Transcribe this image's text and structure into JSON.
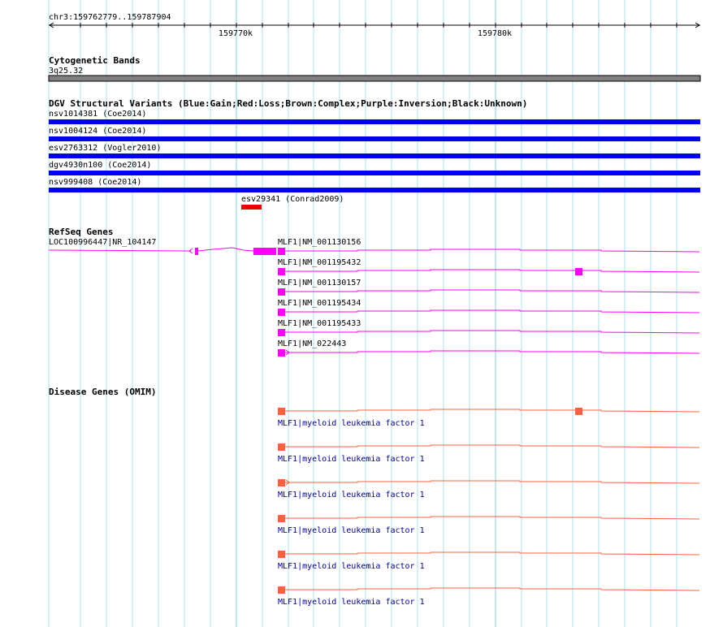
{
  "ruler": {
    "position": "chr3:159762779..159787904",
    "ticks": [
      "159770k",
      "159780k"
    ]
  },
  "cytoband": {
    "title": "Cytogenetic Bands",
    "band": "3q25.32"
  },
  "dgv": {
    "title": "DGV Structural Variants (Blue:Gain;Red:Loss;Brown:Complex;Purple:Inversion;Black:Unknown)",
    "items": [
      {
        "label": "nsv1014381 (Coe2014)",
        "type": "gain"
      },
      {
        "label": "nsv1004124 (Coe2014)",
        "type": "gain"
      },
      {
        "label": "esv2763312 (Vogler2010)",
        "type": "gain"
      },
      {
        "label": "dgv4930n100 (Coe2014)",
        "type": "gain"
      },
      {
        "label": "nsv999408 (Coe2014)",
        "type": "gain"
      },
      {
        "label": "esv29341 (Conrad2009)",
        "type": "loss"
      }
    ]
  },
  "refseq": {
    "title": "RefSeq Genes",
    "loc": "LOC100996447|NR_104147",
    "genes": [
      "MLF1|NM_001130156",
      "MLF1|NM_001195432",
      "MLF1|NM_001130157",
      "MLF1|NM_001195434",
      "MLF1|NM_001195433",
      "MLF1|NM_022443"
    ]
  },
  "omim": {
    "title": "Disease Genes (OMIM)",
    "genes": [
      "MLF1|myeloid leukemia factor 1",
      "MLF1|myeloid leukemia factor 1",
      "MLF1|myeloid leukemia factor 1",
      "MLF1|myeloid leukemia factor 1",
      "MLF1|myeloid leukemia factor 1",
      "MLF1|myeloid leukemia factor 1"
    ]
  },
  "colors": {
    "grid": "#a8e4ec",
    "gridMajor": "#7fcfe0",
    "gain": "#0000ee",
    "loss": "#ee0000",
    "refseq": "#ff00ff",
    "omim": "#ff6040",
    "band": "#808080"
  }
}
